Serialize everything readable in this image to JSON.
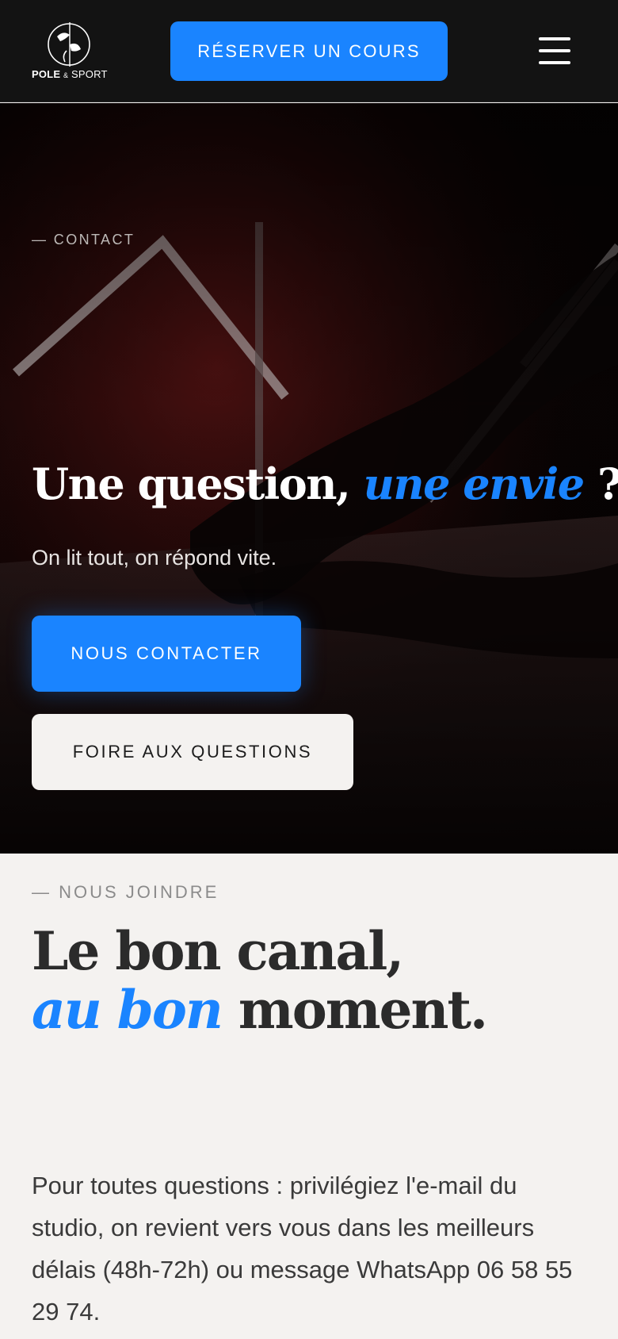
{
  "header": {
    "logo": {
      "brand": "POLE",
      "amp": "&",
      "suffix": "SPORT"
    },
    "book_label": "RÉSERVER UN COURS",
    "menu_icon": "hamburger-menu-icon"
  },
  "hero": {
    "eyebrow": "— CONTACT",
    "title_plain": "Une question, ",
    "title_emphasis": "une envie",
    "title_end": " ?",
    "subtitle": "On lit tout, on répond vite.",
    "contact_label": "NOUS CONTACTER",
    "faq_label": "FOIRE AUX QUESTIONS"
  },
  "section": {
    "eyebrow": "— NOUS JOINDRE",
    "title_line1": "Le bon canal,",
    "title_emphasis": "au bon",
    "title_end": " moment.",
    "body": "Pour toutes questions : privilégiez l'e-mail du studio, on revient vers vous dans les meilleurs délais (48h-72h) ou message WhatsApp 06 58 55 29 74."
  },
  "colors": {
    "accent": "#1a84ff",
    "header_bg": "#131313",
    "page_bg": "#f4f2f0"
  }
}
